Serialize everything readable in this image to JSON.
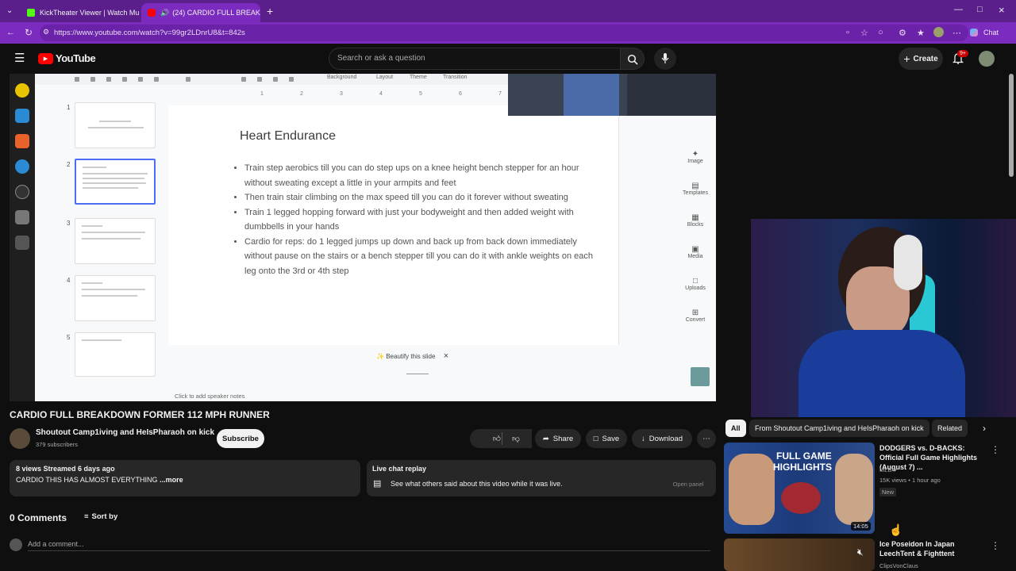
{
  "browser": {
    "tabs": [
      {
        "title": "KickTheater Viewer | Watch Multip",
        "active": false
      },
      {
        "title": "(24) CARDIO FULL BREAKDOWN",
        "active": true
      }
    ],
    "url": "https://www.youtube.com/watch?v=99gr2LDnrU8&t=842s",
    "chat_label": "Chat"
  },
  "header": {
    "logo_text": "YouTube",
    "search_placeholder": "Search or ask a question",
    "create_label": "Create",
    "notifications_badge": "9+"
  },
  "slides": {
    "menu": [
      "Background",
      "Layout",
      "Theme",
      "Transition"
    ],
    "ruler": [
      "1",
      "2",
      "3",
      "4",
      "5",
      "6",
      "7"
    ],
    "thumb_numbers": [
      "1",
      "2",
      "3",
      "4",
      "5"
    ],
    "slide_title": "Heart Endurance",
    "bullets": [
      "Train step aerobics till you can do step ups on a knee height bench stepper for an hour without sweating except a little in your armpits and feet",
      "Then train stair climbing on the max speed till you can do it forever without sweating",
      "Train 1 legged hopping forward with just your bodyweight and then added weight with dumbbells in your hands",
      "Cardio for reps:  do 1 legged jumps up down and back up from back down immediately without pause on the stairs or a bench stepper till you can do it with ankle weights on each leg onto the 3rd or 4th step"
    ],
    "right_tools": [
      "Image",
      "Templates",
      "Blocks",
      "Media",
      "Uploads",
      "Convert"
    ],
    "beautify_label": "Beautify this slide",
    "speaker_notes": "Click to add speaker notes"
  },
  "video": {
    "title": "CARDIO FULL BREAKDOWN FORMER 112 MPH RUNNER",
    "channel": "Shoutout Camp1iving and HeIsPharaoh on kick",
    "subscribers": "379 subscribers",
    "subscribe_label": "Subscribe",
    "like_count": "1",
    "share_label": "Share",
    "save_label": "Save",
    "download_label": "Download",
    "views_meta": "8 views  Streamed 6 days ago",
    "description": "CARDIO THIS HAS ALMOST EVERYTHING",
    "more_label": "...more",
    "live_chat_title": "Live chat replay",
    "live_chat_text": "See what others said about this video while it was live.",
    "open_panel_label": "Open panel"
  },
  "comments": {
    "count_label": "0 Comments",
    "sort_label": "Sort by",
    "add_placeholder": "Add a comment..."
  },
  "sidebar": {
    "chips": [
      "All",
      "From Shoutout Camp1iving and HeIsPharaoh on kick",
      "Related"
    ],
    "recommendations": [
      {
        "title": "DODGERS vs. D-BACKS: Official Full Game Highlights (August 7) ...",
        "channel": "MLB",
        "meta": "15K views • 1 hour ago",
        "badge": "New",
        "duration": "14:05",
        "thumb_text_1": "FULL GAME",
        "thumb_text_2": "HIGHLIGHTS"
      },
      {
        "title": "Ice Poseidon In Japan LeechTent & Fighttent",
        "channel": "ClipsVonClaus"
      }
    ]
  }
}
